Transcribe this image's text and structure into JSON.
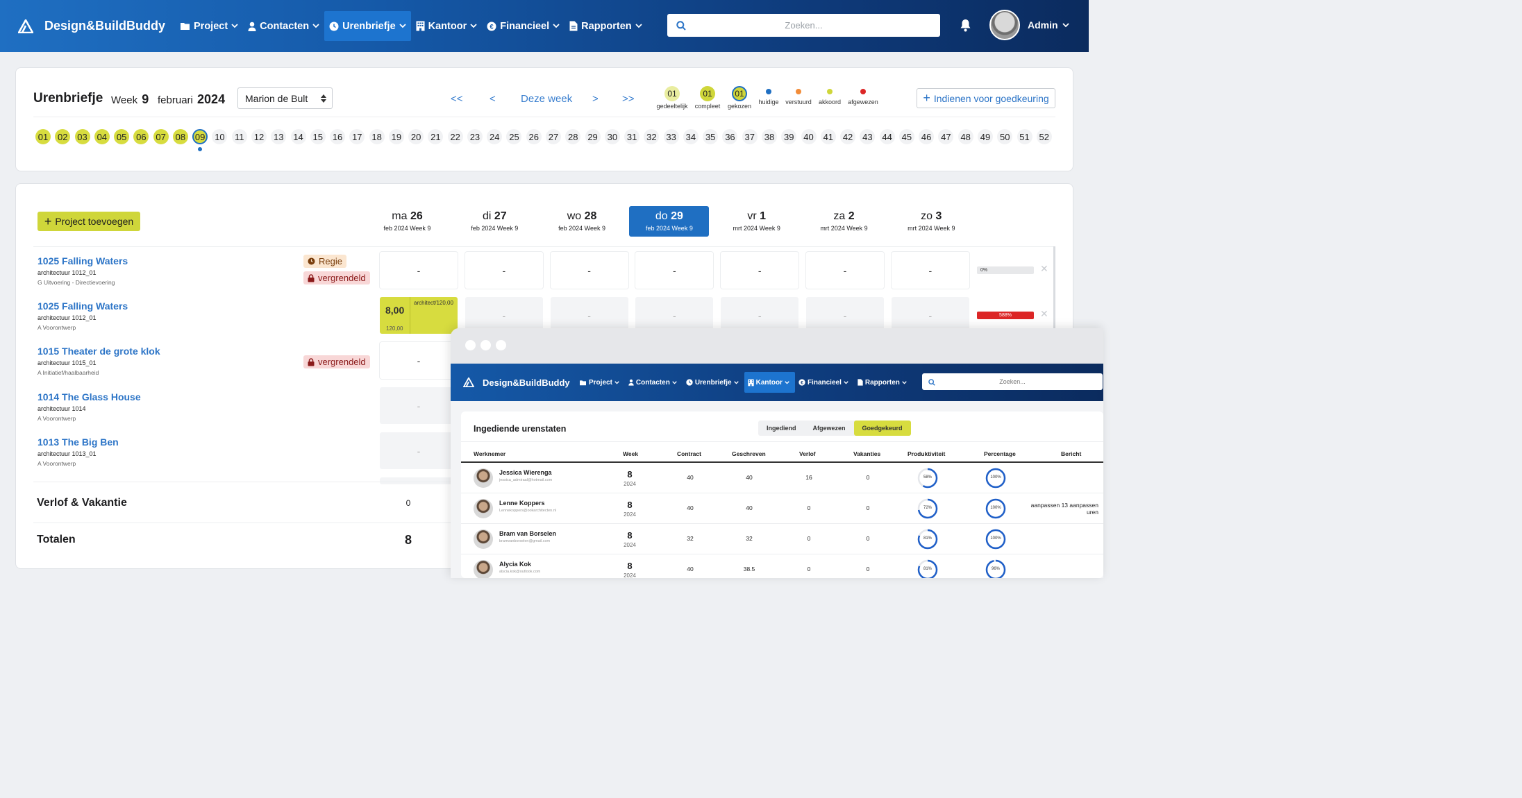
{
  "app": {
    "brand": "Design&BuildBuddy",
    "nav": [
      "Project",
      "Contacten",
      "Urenbriefje",
      "Kantoor",
      "Financieel",
      "Rapporten"
    ],
    "active_nav": "Urenbriefje",
    "search_placeholder": "Zoeken...",
    "user": "Admin"
  },
  "timesheet": {
    "title": "Urenbriefje",
    "week_label": "Week",
    "week_number": "9",
    "month": "februari",
    "year": "2024",
    "employee": "Marion de Bult",
    "nav": {
      "first": "<<",
      "prev": "<",
      "current": "Deze week",
      "next": ">",
      "last": ">>"
    },
    "legend": [
      {
        "label": "gedeeltelijk",
        "text": "01",
        "style": "partial",
        "color": "#e9eda0"
      },
      {
        "label": "compleet",
        "text": "01",
        "style": "complete",
        "color": "#cfd63a"
      },
      {
        "label": "gekozen",
        "text": "01",
        "style": "selected",
        "color": "#cfd63a"
      },
      {
        "label": "huidige",
        "style": "dot",
        "color": "#1f6fc2"
      },
      {
        "label": "verstuurd",
        "style": "dot",
        "color": "#f28c38"
      },
      {
        "label": "akkoord",
        "style": "dot",
        "color": "#cfd63a"
      },
      {
        "label": "afgewezen",
        "style": "dot",
        "color": "#dc2626"
      }
    ],
    "submit_label": "Indienen voor goedkeuring",
    "weeks": [
      "01",
      "02",
      "03",
      "04",
      "05",
      "06",
      "07",
      "08",
      "09",
      "10",
      "11",
      "12",
      "13",
      "14",
      "15",
      "16",
      "17",
      "18",
      "19",
      "20",
      "21",
      "22",
      "23",
      "24",
      "25",
      "26",
      "27",
      "28",
      "29",
      "30",
      "31",
      "32",
      "33",
      "34",
      "35",
      "36",
      "37",
      "38",
      "39",
      "40",
      "41",
      "42",
      "43",
      "44",
      "45",
      "46",
      "47",
      "48",
      "49",
      "50",
      "51",
      "52"
    ],
    "completed_weeks": 8,
    "current_week_index": 8
  },
  "grid": {
    "add_project": "Project toevoegen",
    "days": [
      {
        "dow": "ma",
        "day": "26",
        "sub": "feb 2024 Week 9"
      },
      {
        "dow": "di",
        "day": "27",
        "sub": "feb 2024 Week 9"
      },
      {
        "dow": "wo",
        "day": "28",
        "sub": "feb 2024 Week 9"
      },
      {
        "dow": "do",
        "day": "29",
        "sub": "feb 2024 Week 9"
      },
      {
        "dow": "vr",
        "day": "1",
        "sub": "mrt 2024 Week 9"
      },
      {
        "dow": "za",
        "day": "2",
        "sub": "mrt 2024 Week 9"
      },
      {
        "dow": "zo",
        "day": "3",
        "sub": "mrt 2024 Week 9"
      }
    ],
    "active_day_index": 3,
    "rows": [
      {
        "name": "1025 Falling Waters",
        "code": "architectuur 1012_01",
        "phase": "G Uitvoering - Directievoering",
        "badges": [
          "Regie",
          "vergrendeld"
        ],
        "cells": [
          "-",
          "-",
          "-",
          "-",
          "-",
          "-",
          "-"
        ],
        "progress": "0%"
      },
      {
        "name": "1025 Falling Waters",
        "code": "architectuur 1012_01",
        "phase": "A Voorontwerp",
        "badges": [],
        "cell0": {
          "value": "8,00",
          "sub": "120,00",
          "activity": "architect/120,00"
        },
        "cells": [
          "-",
          "-",
          "-",
          "-",
          "-",
          "-"
        ],
        "progress": "588%"
      },
      {
        "name": "1015 Theater de grote klok",
        "code": "architectuur 1015_01",
        "phase": "A Initiatief/haalbaarheid",
        "badges": [
          "vergrendeld"
        ],
        "cells": [
          "-"
        ]
      },
      {
        "name": "1014 The Glass House",
        "code": "architectuur 1014",
        "phase": "A Voorontwerp",
        "badges": [],
        "cells": [
          "-"
        ]
      },
      {
        "name": "1013 The Big Ben",
        "code": "architectuur 1013_01",
        "phase": "A Voorontwerp",
        "badges": [],
        "cells": [
          "-"
        ]
      }
    ],
    "leave_label": "Verlof & Vakantie",
    "leave_value": "0",
    "totals_label": "Totalen",
    "totals_value": "8"
  },
  "overlay": {
    "brand": "Design&BuildBuddy",
    "nav": [
      "Project",
      "Contacten",
      "Urenbriefje",
      "Kantoor",
      "Financieel",
      "Rapporten"
    ],
    "active_nav": "Kantoor",
    "search_placeholder": "Zoeken...",
    "title": "Ingediende urenstaten",
    "tabs": [
      "Ingediend",
      "Afgewezen",
      "Goedgekeurd"
    ],
    "active_tab": "Goedgekeurd",
    "columns": [
      "Werknemer",
      "Week",
      "Contract",
      "Geschreven",
      "Verlof",
      "Vakanties",
      "Produktiviteit",
      "Percentage",
      "Bericht"
    ],
    "rows": [
      {
        "name": "Jessica Wierenga",
        "email": "jessica_admiraal@hotmail.com",
        "week": "8",
        "year": "2024",
        "contract": "40",
        "written": "40",
        "leave": "16",
        "holidays": "0",
        "productivity": 58,
        "percentage": 100,
        "message": ""
      },
      {
        "name": "Lenne Koppers",
        "email": "Lennekoppers@ookarchitecten.nl",
        "week": "8",
        "year": "2024",
        "contract": "40",
        "written": "40",
        "leave": "0",
        "holidays": "0",
        "productivity": 72,
        "percentage": 100,
        "message": "aanpassen 13 aanpassen uren"
      },
      {
        "name": "Bram van Borselen",
        "email": "bramvanborselen@gmail.com",
        "week": "8",
        "year": "2024",
        "contract": "32",
        "written": "32",
        "leave": "0",
        "holidays": "0",
        "productivity": 81,
        "percentage": 100,
        "message": ""
      },
      {
        "name": "Alycia Kok",
        "email": "alycia.kok@outlook.com",
        "week": "8",
        "year": "2024",
        "contract": "40",
        "written": "38.5",
        "leave": "0",
        "holidays": "0",
        "productivity": 81,
        "percentage": 96,
        "message": ""
      }
    ]
  }
}
